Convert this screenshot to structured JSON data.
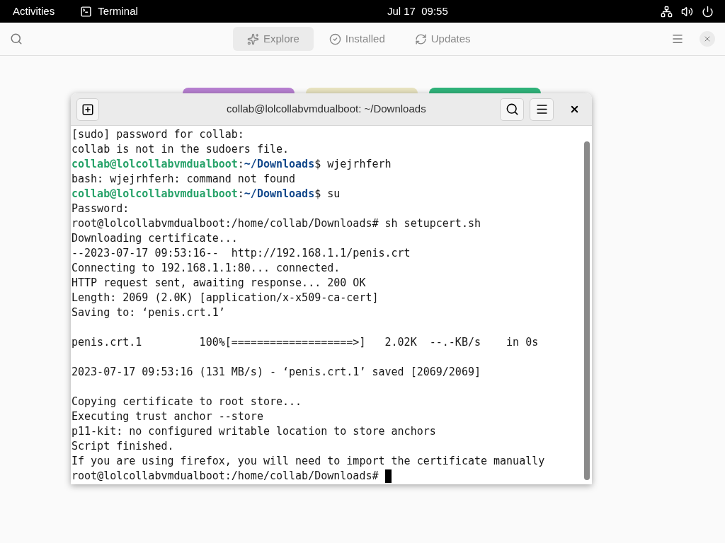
{
  "top_bar": {
    "activities": "Activities",
    "app_name": "Terminal",
    "clock": "Jul 17  09:55"
  },
  "software_app": {
    "tabs": [
      {
        "label": "Explore",
        "kind": "explore",
        "selected": true
      },
      {
        "label": "Installed",
        "kind": "installed",
        "selected": false
      },
      {
        "label": "Updates",
        "kind": "updates",
        "selected": false
      }
    ],
    "banners": [
      {
        "color": "#b77fd1"
      },
      {
        "color": "#e8e3c0"
      },
      {
        "color": "#2fb37a"
      }
    ]
  },
  "terminal": {
    "title": "collab@lolcollabvmdualboot: ~/Downloads",
    "lines": [
      {
        "kind": "plain",
        "text": "[sudo] password for collab:"
      },
      {
        "kind": "plain",
        "text": "collab is not in the sudoers file."
      },
      {
        "kind": "prompt",
        "user": "collab@lolcollabvmdualboot",
        "sep": ":",
        "path": "~/Downloads",
        "command": "$ wjejrhferh"
      },
      {
        "kind": "plain",
        "text": "bash: wjejrhferh: command not found"
      },
      {
        "kind": "prompt",
        "user": "collab@lolcollabvmdualboot",
        "sep": ":",
        "path": "~/Downloads",
        "command": "$ su"
      },
      {
        "kind": "plain",
        "text": "Password:"
      },
      {
        "kind": "plain",
        "text": "root@lolcollabvmdualboot:/home/collab/Downloads# sh setupcert.sh"
      },
      {
        "kind": "plain",
        "text": "Downloading certificate..."
      },
      {
        "kind": "plain",
        "text": "--2023-07-17 09:53:16--  http://192.168.1.1/penis.crt"
      },
      {
        "kind": "plain",
        "text": "Connecting to 192.168.1.1:80... connected."
      },
      {
        "kind": "plain",
        "text": "HTTP request sent, awaiting response... 200 OK"
      },
      {
        "kind": "plain",
        "text": "Length: 2069 (2.0K) [application/x-x509-ca-cert]"
      },
      {
        "kind": "plain",
        "text": "Saving to: ‘penis.crt.1’"
      },
      {
        "kind": "blank"
      },
      {
        "kind": "plain",
        "text": "penis.crt.1         100%[===================>]   2.02K  --.-KB/s    in 0s"
      },
      {
        "kind": "blank"
      },
      {
        "kind": "plain",
        "text": "2023-07-17 09:53:16 (131 MB/s) - ‘penis.crt.1’ saved [2069/2069]"
      },
      {
        "kind": "blank"
      },
      {
        "kind": "plain",
        "text": "Copying certificate to root store..."
      },
      {
        "kind": "plain",
        "text": "Executing trust anchor --store"
      },
      {
        "kind": "plain",
        "text": "p11-kit: no configured writable location to store anchors"
      },
      {
        "kind": "plain",
        "text": "Script finished."
      },
      {
        "kind": "plain",
        "text": "If you are using firefox, you will need to import the certificate manually"
      },
      {
        "kind": "cursor",
        "text": "root@lolcollabvmdualboot:/home/collab/Downloads# "
      }
    ]
  }
}
